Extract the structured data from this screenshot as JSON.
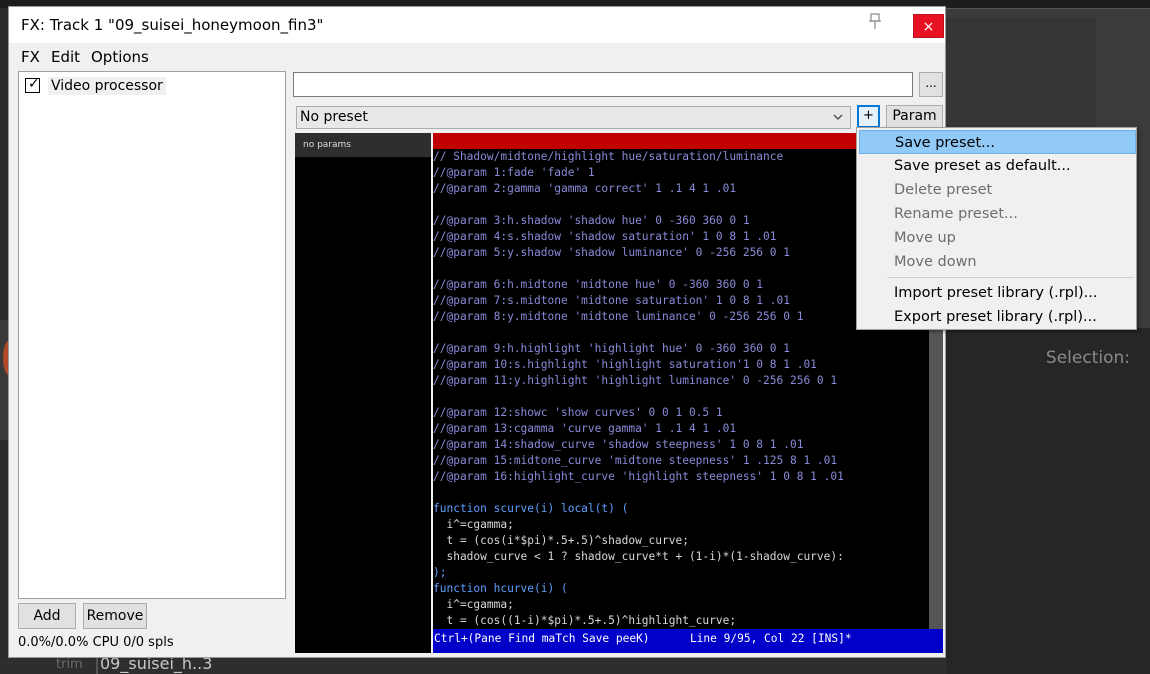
{
  "window": {
    "title": "FX: Track 1 \"09_suisei_honeymoon_fin3\"",
    "close_label": "×",
    "pin_label": "⊼"
  },
  "menu": [
    "FX",
    "Edit",
    "Options"
  ],
  "fx_list": {
    "items": [
      {
        "label": "Video processor",
        "checked": true
      }
    ],
    "add_label": "Add",
    "remove_label": "Remove",
    "cpu_text": "0.0%/0.0% CPU 0/0 spls"
  },
  "toolbar": {
    "dots_label": "...",
    "preset_value": "No preset",
    "plus_label": "+",
    "param_label": "Param"
  },
  "params_panel": {
    "header": "no params"
  },
  "code": {
    "lines": [
      {
        "t": "// Shadow/midtone/highlight hue/saturation/luminance",
        "k": "c"
      },
      {
        "t": "//@param 1:fade 'fade' 1",
        "k": "c"
      },
      {
        "t": "//@param 2:gamma 'gamma correct' 1 .1 4 1 .01",
        "k": "c"
      },
      {
        "t": "",
        "k": "c"
      },
      {
        "t": "//@param 3:h.shadow 'shadow hue' 0 -360 360 0 1",
        "k": "c"
      },
      {
        "t": "//@param 4:s.shadow 'shadow saturation' 1 0 8 1 .01",
        "k": "c"
      },
      {
        "t": "//@param 5:y.shadow 'shadow luminance' 0 -256 256 0 1",
        "k": "c"
      },
      {
        "t": "",
        "k": "c"
      },
      {
        "t": "//@param 6:h.midtone 'midtone hue' 0 -360 360 0 1",
        "k": "c"
      },
      {
        "t": "//@param 7:s.midtone 'midtone saturation' 1 0 8 1 .01",
        "k": "c"
      },
      {
        "t": "//@param 8:y.midtone 'midtone luminance' 0 -256 256 0 1",
        "k": "c"
      },
      {
        "t": "",
        "k": "c"
      },
      {
        "t": "//@param 9:h.highlight 'highlight hue' 0 -360 360 0 1",
        "k": "c"
      },
      {
        "t": "//@param 10:s.highlight 'highlight saturation'1 0 8 1 .01",
        "k": "c"
      },
      {
        "t": "//@param 11:y.highlight 'highlight luminance' 0 -256 256 0 1",
        "k": "c"
      },
      {
        "t": "",
        "k": "c"
      },
      {
        "t": "//@param 12:showc 'show curves' 0 0 1 0.5 1",
        "k": "c"
      },
      {
        "t": "//@param 13:cgamma 'curve gamma' 1 .1 4 1 .01",
        "k": "c"
      },
      {
        "t": "//@param 14:shadow_curve 'shadow steepness' 1 0 8 1 .01",
        "k": "c"
      },
      {
        "t": "//@param 15:midtone_curve 'midtone steepness' 1 .125 8 1 .01",
        "k": "c"
      },
      {
        "t": "//@param 16:highlight_curve 'highlight steepness' 1 0 8 1 .01",
        "k": "c"
      },
      {
        "t": "",
        "k": "c"
      },
      {
        "t": "function scurve(i) local(t) (",
        "k": "fn"
      },
      {
        "t": "  i^=cgamma;",
        "k": "body"
      },
      {
        "t": "  t = (cos(i*$pi)*.5+.5)^shadow_curve;",
        "k": "body"
      },
      {
        "t": "  shadow_curve < 1 ? shadow_curve*t + (1-i)*(1-shadow_curve):",
        "k": "body"
      },
      {
        "t": ");",
        "k": "fn"
      },
      {
        "t": "function hcurve(i) (",
        "k": "fn"
      },
      {
        "t": "  i^=cgamma;",
        "k": "body"
      },
      {
        "t": "  t = (cos((1-i)*$pi)*.5+.5)^highlight_curve;",
        "k": "body"
      }
    ],
    "status": "Ctrl+(Pane Find maTch Save peeK)      Line 9/95, Col 22 [INS]*"
  },
  "context_menu": {
    "items": [
      {
        "label": "Save preset...",
        "state": "selected"
      },
      {
        "label": "Save preset as default...",
        "state": "enabled"
      },
      {
        "label": "Delete preset",
        "state": "disabled"
      },
      {
        "label": "Rename preset...",
        "state": "disabled"
      },
      {
        "label": "Move up",
        "state": "disabled"
      },
      {
        "label": "Move down",
        "state": "disabled"
      },
      {
        "label": "Import preset library (.rpl)...",
        "state": "enabled"
      },
      {
        "label": "Export preset library (.rpl)...",
        "state": "enabled"
      }
    ]
  },
  "background": {
    "selection_label": "Selection:",
    "trim_label": "trim",
    "item_label": "09_suisei_h..3"
  }
}
